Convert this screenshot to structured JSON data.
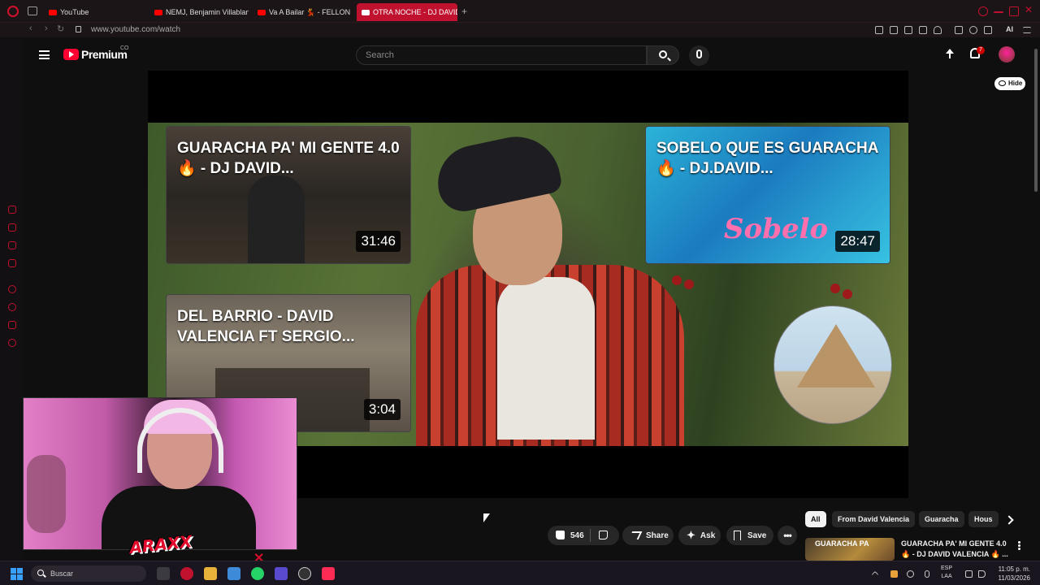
{
  "browser": {
    "tabs": [
      {
        "title": "YouTube",
        "active": false
      },
      {
        "title": "NEMJ, Benjamin Villablanc",
        "active": false
      },
      {
        "title": "Va A Bailar 💃 - FELLON",
        "active": false
      },
      {
        "title": "OTRA NOCHE - DJ DAVID",
        "active": true
      }
    ],
    "url": "www.youtube.com/watch",
    "ai_label": "AI",
    "accent_color": "#c0122e"
  },
  "header": {
    "brand": "Premium",
    "country": "CO",
    "search_placeholder": "Search",
    "notification_count": "7"
  },
  "player": {
    "hide_label": "Hide",
    "end_cards": [
      {
        "title": "GUARACHA PA' MI GENTE 4.0 🔥 - DJ DAVID...",
        "duration": "31:46"
      },
      {
        "title": "SOBELO QUE ES GUARACHA 🔥 - DJ.DAVID...",
        "duration": "28:47"
      },
      {
        "title": "DEL BARRIO - DAVID VALENCIA FT SERGIO...",
        "duration": "3:04"
      }
    ]
  },
  "actions": {
    "like_count": "546",
    "share_label": "Share",
    "ask_label": "Ask",
    "save_label": "Save"
  },
  "chips": [
    "All",
    "From David Valencia",
    "Guaracha",
    "Hous"
  ],
  "recommendation": {
    "title": "GUARACHA PA' MI GENTE 4.0 🔥 - DJ DAVID VALENCIA 🔥 ..."
  },
  "taskbar": {
    "search_label": "Buscar",
    "lang_line1": "ESP",
    "lang_line2": "LAA",
    "time": "11:05 p. m.",
    "date": "11/03/2026"
  }
}
